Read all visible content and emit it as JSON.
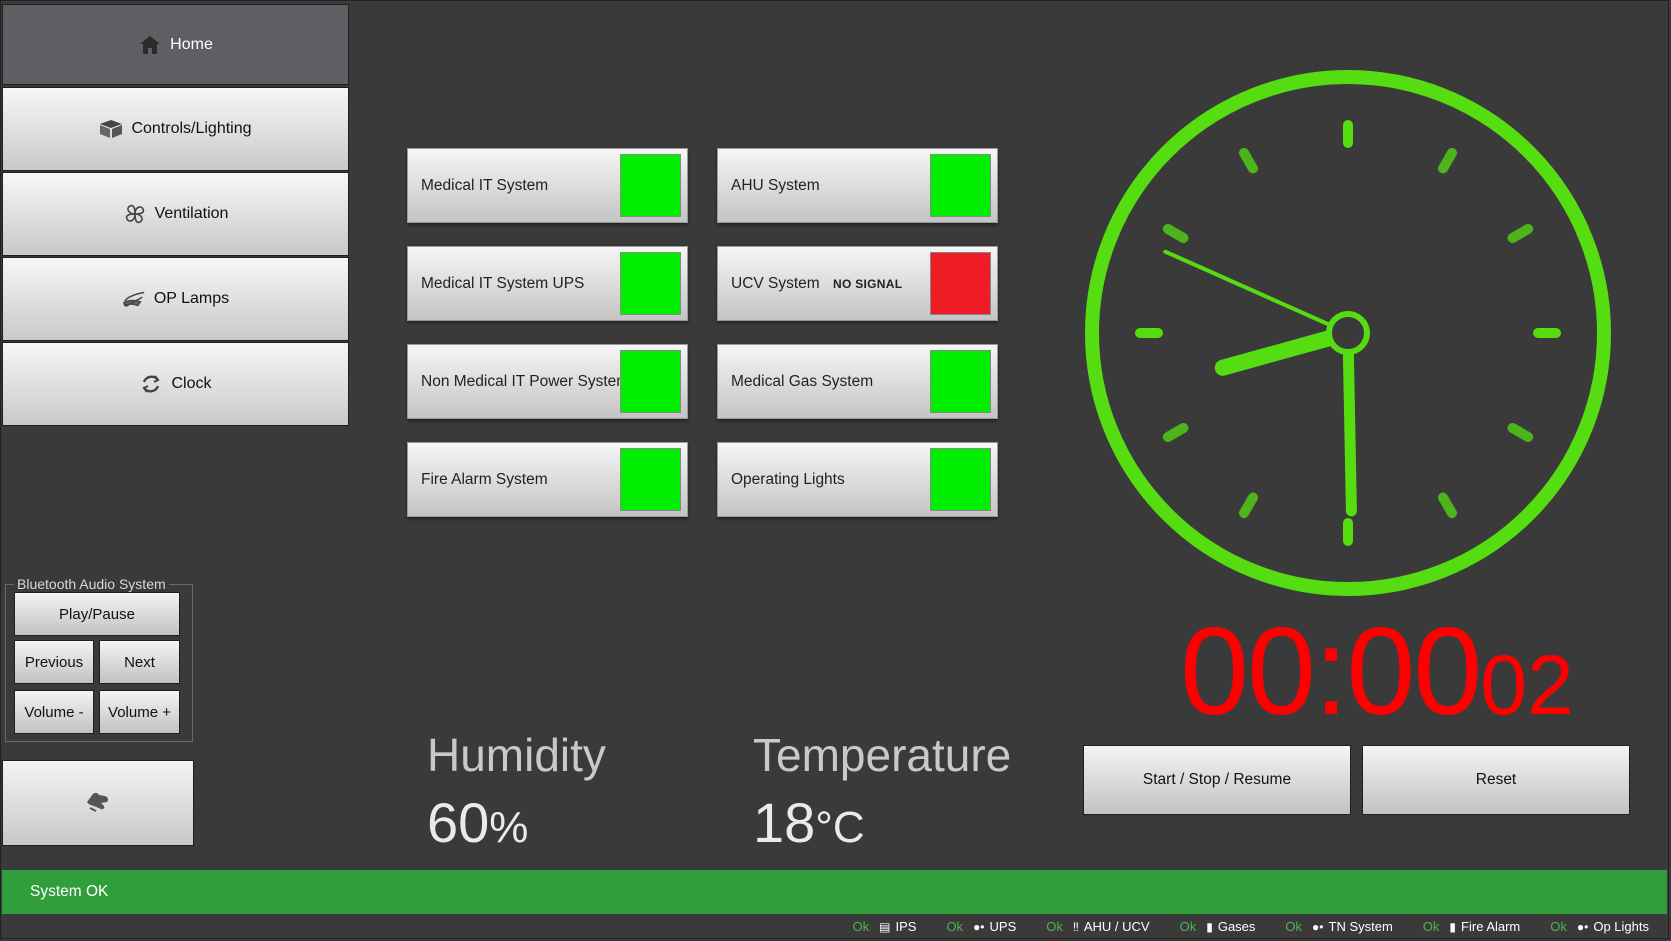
{
  "nav": [
    {
      "label": "Home",
      "icon": "home-icon",
      "active": true
    },
    {
      "label": "Controls/Lighting",
      "icon": "box-icon",
      "active": false
    },
    {
      "label": "Ventilation",
      "icon": "fan-icon",
      "active": false
    },
    {
      "label": "OP Lamps",
      "icon": "lamp-icon",
      "active": false
    },
    {
      "label": "Clock",
      "icon": "refresh-icon",
      "active": false
    }
  ],
  "systems": [
    {
      "name": "Medical IT System",
      "note": "",
      "status": "#00ee00"
    },
    {
      "name": "AHU System",
      "note": "",
      "status": "#00ee00"
    },
    {
      "name": "Medical IT System UPS",
      "note": "",
      "status": "#00ee00"
    },
    {
      "name": "UCV System",
      "note": "NO SIGNAL",
      "status": "#ee1c24"
    },
    {
      "name": "Non Medical IT Power System",
      "note": "",
      "status": "#00ee00"
    },
    {
      "name": "Medical Gas System",
      "note": "",
      "status": "#00ee00"
    },
    {
      "name": "Fire Alarm System",
      "note": "",
      "status": "#00ee00"
    },
    {
      "name": "Operating Lights",
      "note": "",
      "status": "#00ee00"
    }
  ],
  "bluetooth": {
    "legend": "Bluetooth Audio System",
    "play_pause": "Play/Pause",
    "previous": "Previous",
    "next": "Next",
    "volume_down": "Volume -",
    "volume_up": "Volume +"
  },
  "readouts": {
    "humidity_label": "Humidity",
    "humidity_value": "60",
    "humidity_unit": "%",
    "temperature_label": "Temperature",
    "temperature_value": "18",
    "temperature_unit": "°C"
  },
  "clock": {
    "time_hours": 8,
    "time_minutes": 29,
    "time_seconds": 49,
    "color": "#55dd11"
  },
  "timer": {
    "main": "00:00",
    "seconds": "02",
    "color": "#ff0000",
    "start_label": "Start / Stop / Resume",
    "reset_label": "Reset"
  },
  "status": {
    "text": "System OK",
    "color": "#2f9e3b"
  },
  "footer": [
    {
      "ok": "Ok",
      "label": "IPS",
      "icon": "ips-icon"
    },
    {
      "ok": "Ok",
      "label": "UPS",
      "icon": "plug-icon"
    },
    {
      "ok": "Ok",
      "label": "AHU / UCV",
      "icon": "thermometer-icon"
    },
    {
      "ok": "Ok",
      "label": "Gases",
      "icon": "gas-bottle-icon"
    },
    {
      "ok": "Ok",
      "label": "TN System",
      "icon": "plug-icon"
    },
    {
      "ok": "Ok",
      "label": "Fire Alarm",
      "icon": "extinguisher-icon"
    },
    {
      "ok": "Ok",
      "label": "Op Lights",
      "icon": "plug-icon"
    }
  ]
}
